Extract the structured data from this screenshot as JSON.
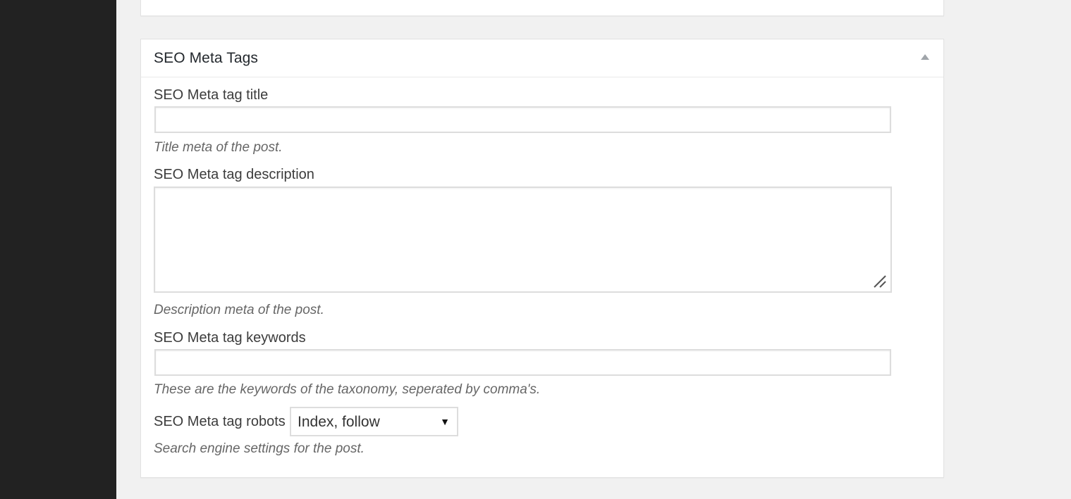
{
  "metabox": {
    "title": "SEO Meta Tags",
    "toggle_icon": "triangle-up-icon"
  },
  "fields": {
    "title": {
      "label": "SEO Meta tag title",
      "value": "",
      "help": "Title meta of the post."
    },
    "description": {
      "label": "SEO Meta tag description",
      "value": "",
      "help": "Description meta of the post."
    },
    "keywords": {
      "label": "SEO Meta tag keywords",
      "value": "",
      "help": "These are the keywords of the taxonomy, seperated by comma's."
    },
    "robots": {
      "label": "SEO Meta tag robots",
      "selected": "Index, follow",
      "help": "Search engine settings for the post."
    }
  },
  "colors": {
    "sidebar": "#222222",
    "page_background": "#f1f1f1",
    "box_background": "#ffffff",
    "border": "#dddddd"
  }
}
